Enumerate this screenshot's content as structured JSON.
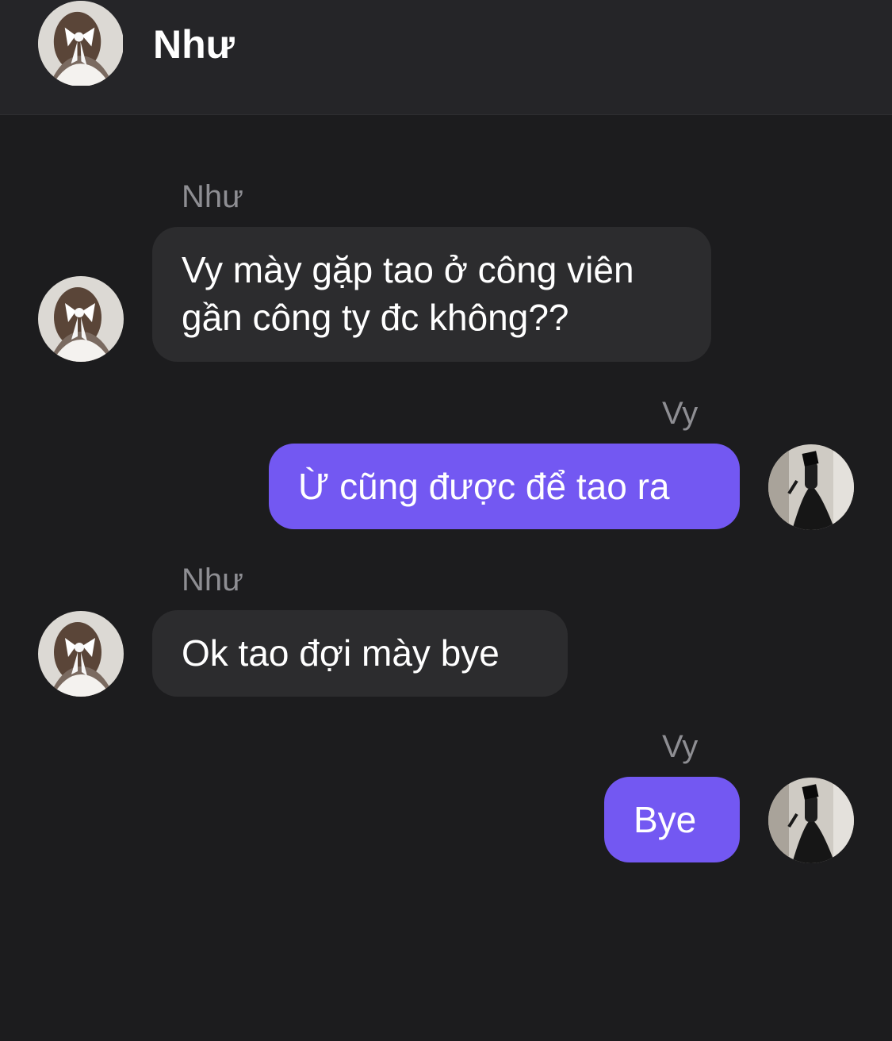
{
  "header": {
    "contact_name": "Như",
    "avatar_icon": "girl-with-bow-avatar"
  },
  "colors": {
    "background": "#1c1c1e",
    "header_background": "#252528",
    "incoming_bubble": "#2c2c2e",
    "outgoing_bubble": "#7358f2",
    "sender_name": "#8e8e93",
    "text": "#ffffff"
  },
  "messages": [
    {
      "sender": "Như",
      "direction": "incoming",
      "lines": [
        "Vy mày gặp tao ở công viên",
        "gần công ty đc không??"
      ]
    },
    {
      "sender": "Vy",
      "direction": "outgoing",
      "lines": [
        "Ừ cũng được để tao ra"
      ]
    },
    {
      "sender": "Như",
      "direction": "incoming",
      "lines": [
        "Ok tao đợi mày bye"
      ]
    },
    {
      "sender": "Vy",
      "direction": "outgoing",
      "lines": [
        "Bye"
      ]
    }
  ]
}
